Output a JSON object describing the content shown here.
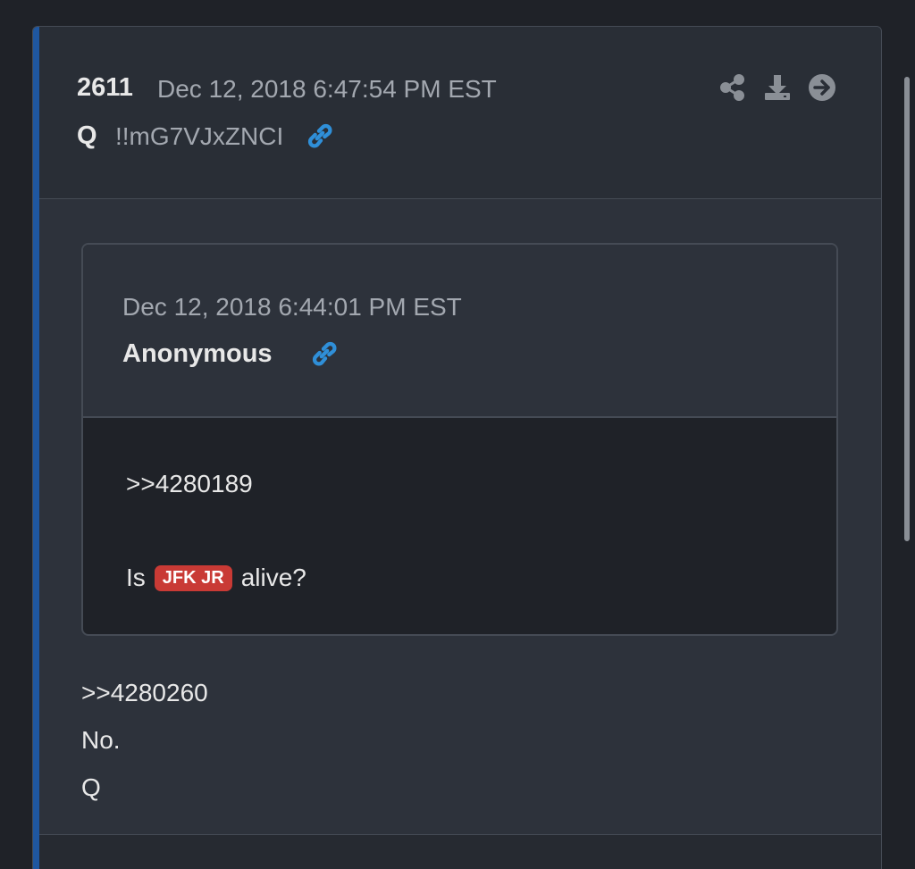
{
  "post": {
    "number": "2611",
    "date": "Dec 12, 2018 6:47:54 PM EST",
    "author": "Q",
    "tripcode": "!!mG7VJxZNCI",
    "actions": {
      "share_icon": "share-icon",
      "download_icon": "download-icon",
      "next_icon": "arrow-right-circle-icon"
    }
  },
  "quoted_post": {
    "date": "Dec 12, 2018 6:44:01 PM EST",
    "author": "Anonymous",
    "reference": ">>4280189",
    "text_before": "Is",
    "tag": "JFK JR",
    "text_after": "alive?"
  },
  "reply": {
    "reference": ">>4280260",
    "text": "No.",
    "signature": "Q"
  },
  "colors": {
    "accent": "#1f57a0",
    "link_icon": "#2f8fd8",
    "tag_badge": "#c93a35"
  }
}
